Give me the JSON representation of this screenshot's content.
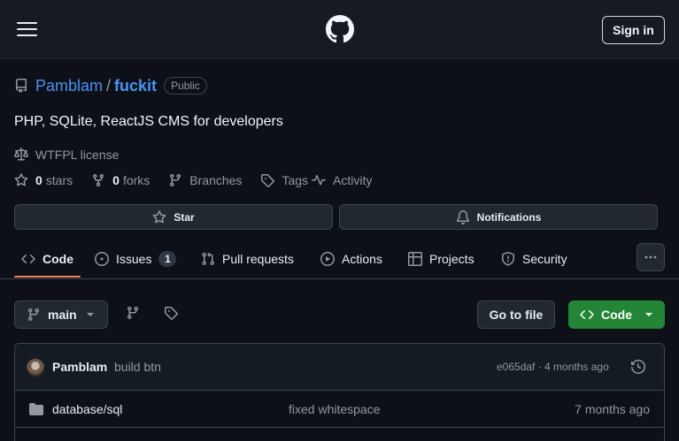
{
  "header": {
    "menu_icon": "hamburger-icon",
    "logo_icon": "github-logo-icon",
    "signin_label": "Sign in"
  },
  "repo": {
    "owner": "Pamblam",
    "separator": "/",
    "name": "fuckit",
    "visibility": "Public",
    "description": "PHP, SQLite, ReactJS CMS for developers",
    "license": "WTFPL license",
    "stars_count": "0",
    "stars_label": "stars",
    "forks_count": "0",
    "forks_label": "forks",
    "branches_label": "Branches",
    "tags_label": "Tags",
    "activity_label": "Activity"
  },
  "actions": {
    "star_label": "Star",
    "notifications_label": "Notifications"
  },
  "tabs": [
    {
      "label": "Code",
      "icon": "code-icon",
      "active": true
    },
    {
      "label": "Issues",
      "icon": "issue-opened-icon",
      "count": "1"
    },
    {
      "label": "Pull requests",
      "icon": "git-pull-request-icon"
    },
    {
      "label": "Actions",
      "icon": "play-icon"
    },
    {
      "label": "Projects",
      "icon": "table-icon"
    },
    {
      "label": "Security",
      "icon": "shield-icon"
    }
  ],
  "toolbar": {
    "branch": "main",
    "goto_file_label": "Go to file",
    "code_label": "Code"
  },
  "latest_commit": {
    "author": "Pamblam",
    "message": "build btn",
    "meta": "e065daf · 4 months ago"
  },
  "files": [
    {
      "name": "database/sql",
      "message": "fixed whitespace",
      "age": "7 months ago",
      "type": "folder"
    }
  ],
  "colors": {
    "accent_link": "#4493f8",
    "code_button": "#238636",
    "active_tab_underline": "#f78166",
    "background": "#0d1117"
  }
}
